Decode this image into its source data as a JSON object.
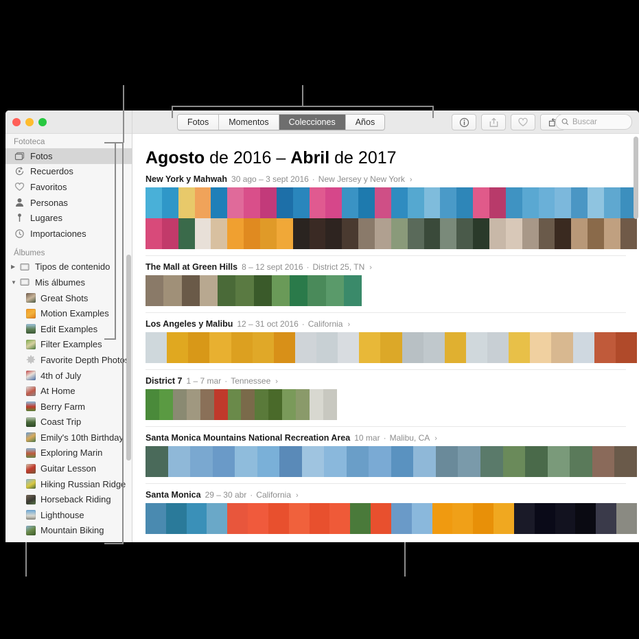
{
  "window": {
    "traffic_lights": [
      "close",
      "minimize",
      "zoom"
    ],
    "colors": {
      "close": "#ff5f57",
      "minimize": "#febc2e",
      "zoom": "#28c840",
      "accent_selected": "#6e6e6e"
    }
  },
  "sidebar": {
    "sections": [
      {
        "header": "Fototeca",
        "items": [
          {
            "label": "Fotos",
            "icon": "photos-stack-icon",
            "selected": true
          },
          {
            "label": "Recuerdos",
            "icon": "memories-icon",
            "selected": false
          },
          {
            "label": "Favoritos",
            "icon": "heart-icon",
            "selected": false
          },
          {
            "label": "Personas",
            "icon": "person-icon",
            "selected": false
          },
          {
            "label": "Lugares",
            "icon": "map-pin-icon",
            "selected": false
          },
          {
            "label": "Importaciones",
            "icon": "clock-icon",
            "selected": false
          }
        ]
      },
      {
        "header": "Álbumes",
        "items": [
          {
            "label": "Tipos de contenido",
            "icon": "folder-icon",
            "expanded": false,
            "group": true
          },
          {
            "label": "Mis álbumes",
            "icon": "folder-icon",
            "expanded": true,
            "group": true
          },
          {
            "label": "Great Shots",
            "icon": "album-thumb",
            "thumb": "linear-gradient(150deg,#6f5a4a,#c8b49a 50%,#4a5a42)"
          },
          {
            "label": "Motion Examples",
            "icon": "album-thumb",
            "thumb": "linear-gradient(150deg,#f79a24,#f2b33c 50%,#e07a18)"
          },
          {
            "label": "Edit Examples",
            "icon": "album-thumb",
            "thumb": "linear-gradient(180deg,#9fc6e0,#5d7f54 55%,#3e5c38)"
          },
          {
            "label": "Filter Examples",
            "icon": "album-thumb",
            "thumb": "linear-gradient(150deg,#7fae4e,#d6d0a0 50%,#4a7a3a)"
          },
          {
            "label": "Favorite Depth Photos",
            "icon": "gear-icon"
          },
          {
            "label": "4th of July",
            "icon": "album-thumb",
            "thumb": "linear-gradient(150deg,#c94a4a,#e8e0d8 45%,#4a6fa8)"
          },
          {
            "label": "At Home",
            "icon": "album-thumb",
            "thumb": "linear-gradient(150deg,#e2e2e2,#c05a4a 55%,#8a8a8a)"
          },
          {
            "label": "Berry Farm",
            "icon": "album-thumb",
            "thumb": "linear-gradient(180deg,#8fc0e2,#c0392b 55%,#5a8a3a)"
          },
          {
            "label": "Coast Trip",
            "icon": "album-thumb",
            "thumb": "linear-gradient(180deg,#b8c9b0,#4a6a3a 50%,#2e4a28)"
          },
          {
            "label": "Emily's 10th Birthday",
            "icon": "album-thumb",
            "thumb": "linear-gradient(150deg,#6aa0d8,#d8a85a 50%,#4a7a4a)"
          },
          {
            "label": "Exploring Marin",
            "icon": "album-thumb",
            "thumb": "linear-gradient(180deg,#8fb8d8,#c05a3a 55%,#6a8a4a)"
          },
          {
            "label": "Guitar Lesson",
            "icon": "album-thumb",
            "thumb": "linear-gradient(150deg,#d8c8b0,#c0392b 50%,#7a5a3a)"
          },
          {
            "label": "Hiking Russian Ridge",
            "icon": "album-thumb",
            "thumb": "linear-gradient(150deg,#8fb8d8,#d8c840 55%,#4a6a3a)"
          },
          {
            "label": "Horseback Riding",
            "icon": "album-thumb",
            "thumb": "linear-gradient(150deg,#7a6a5a,#3a3a32 55%,#5a7a4a)"
          },
          {
            "label": "Lighthouse",
            "icon": "album-thumb",
            "thumb": "linear-gradient(180deg,#6aa8d8,#d8d8d0 60%,#8a8a82)"
          },
          {
            "label": "Mountain Biking",
            "icon": "album-thumb",
            "thumb": "linear-gradient(150deg,#8fb8d8,#6a8a4a 50%,#3a5a2a)"
          }
        ]
      }
    ]
  },
  "toolbar": {
    "tabs": [
      {
        "label": "Fotos",
        "active": false
      },
      {
        "label": "Momentos",
        "active": false
      },
      {
        "label": "Colecciones",
        "active": true
      },
      {
        "label": "Años",
        "active": false
      }
    ],
    "buttons": [
      {
        "name": "info-button",
        "icon": "info-circle-icon"
      },
      {
        "name": "share-button",
        "icon": "share-icon"
      },
      {
        "name": "favorite-button",
        "icon": "heart-icon"
      },
      {
        "name": "rotate-button",
        "icon": "rotate-icon"
      }
    ],
    "search": {
      "placeholder": "Buscar",
      "icon": "search-icon"
    }
  },
  "main": {
    "title": {
      "month_start": "Agosto",
      "year_start": "de 2016",
      "dash": "–",
      "month_end": "Abril",
      "year_end": "de 2017"
    },
    "collections": [
      {
        "name": "New York y Mahwah",
        "date": "30 ago – 3 sept 2016",
        "place": "New Jersey y New York",
        "chevron": "›",
        "rows": 2,
        "photo_height": 45,
        "photos_top": [
          "#49b0d8",
          "#2f97c8",
          "#e8c96a",
          "#f0a35a",
          "#1f7fb8",
          "#e06a9a",
          "#d94f8a",
          "#c23a7a",
          "#1d6fa8",
          "#2a86bc",
          "#e05a90",
          "#d6478a",
          "#3a93c4",
          "#1e7aae",
          "#cf4f86",
          "#2f8cc0",
          "#55a8d0",
          "#7fbcdc",
          "#4a9ac8",
          "#2e86b8",
          "#e05a8a",
          "#b83a6a",
          "#3f93c2",
          "#5aa8d2",
          "#6ab0d8",
          "#7cb8dc",
          "#4a96c4",
          "#8fc4e0",
          "#5fa8d0",
          "#3c8fbe"
        ],
        "photos_bottom": [
          "#d84a7a",
          "#c23a6a",
          "#3a6a4a",
          "#e8e0d8",
          "#d8c0a0",
          "#f0a030",
          "#e08a20",
          "#e09a28",
          "#f0a838",
          "#2a2420",
          "#3a2a24",
          "#2e2420",
          "#4a3a30",
          "#8a7a6a",
          "#b0a090",
          "#8a9a7a",
          "#5a6a5a",
          "#3a4a3a",
          "#7a8a7a",
          "#4a5a4a",
          "#2a3a2a",
          "#c8b8a8",
          "#d8c8b8",
          "#a89888",
          "#6a5a4a",
          "#3a2a20",
          "#b89878",
          "#8a6a4a",
          "#c0a080",
          "#705a48"
        ]
      },
      {
        "name": "The Mall at Green Hills",
        "date": "8 – 12 sept 2016",
        "place": "District 25, TN",
        "chevron": "›",
        "rows": 1,
        "photo_height": 45,
        "photos_top": [
          "#8a7a68",
          "#a09078",
          "#6a5a48",
          "#b8a890",
          "#4a6a38",
          "#5a7a42",
          "#3a5a2a",
          "#6a9a58",
          "#2a7a4a",
          "#4a8a5a",
          "#5a9a6a",
          "#3a8a6a"
        ],
        "photos_bottom": []
      },
      {
        "name": "Los Angeles y Malibu",
        "date": "12 – 31 oct 2016",
        "place": "California",
        "chevron": "›",
        "rows": 1,
        "photo_height": 45,
        "photos_top": [
          "#cfd8dc",
          "#e0a820",
          "#d89818",
          "#e8b030",
          "#dca020",
          "#e0a828",
          "#d89018",
          "#cfd4d8",
          "#c8d0d4",
          "#d8dce0",
          "#e8b838",
          "#dca828",
          "#b8c0c4",
          "#c0c8cc",
          "#e0b030",
          "#d0d8dc",
          "#c8cfd4",
          "#e8c048",
          "#f0d0a0",
          "#d8b890",
          "#cfd8e0",
          "#c05a3a",
          "#b04a2a"
        ],
        "photos_bottom": []
      },
      {
        "name": "District 7",
        "date": "1 – 7 mar",
        "place": "Tennessee",
        "chevron": "›",
        "rows": 1,
        "photo_height": 45,
        "photos_top": [
          "#4a8a3a",
          "#5a9a42",
          "#8a8a72",
          "#a09880",
          "#8a7058",
          "#c0392b",
          "#6a8a4a",
          "#7a6a4a",
          "#5a7a3a",
          "#4a6a2a",
          "#7a9a5a",
          "#8a9a6a",
          "#d8d8d0",
          "#c8c8c0"
        ],
        "photos_bottom": []
      },
      {
        "name": "Santa Monica Mountains National Recreation Area",
        "date": "10 mar",
        "place": "Malibu, CA",
        "chevron": "›",
        "rows": 1,
        "photo_height": 45,
        "photos_top": [
          "#4a6a5a",
          "#8fb8d8",
          "#7aa8d0",
          "#6a9ac8",
          "#8fbcdc",
          "#7ab0d8",
          "#5a8ab8",
          "#9fc4e0",
          "#8ab8dc",
          "#6a9ec8",
          "#7aaad4",
          "#5a92c0",
          "#8fb8d8",
          "#6a8a9a",
          "#7a9aaa",
          "#5a7a6a",
          "#6a8a5a",
          "#4a6a4a",
          "#7a9a7a",
          "#5a7a5a",
          "#8a6a5a",
          "#6a5a4a"
        ],
        "photos_bottom": []
      },
      {
        "name": "Santa Monica",
        "date": "29 – 30 abr",
        "place": "California",
        "chevron": "›",
        "rows": 1,
        "photo_height": 45,
        "photos_top": [
          "#4a8ab0",
          "#2a7a9a",
          "#3a90b8",
          "#6aa8c8",
          "#e8563c",
          "#f05a3c",
          "#e8502e",
          "#f0613c",
          "#e8502e",
          "#ef5a38",
          "#4a7a3a",
          "#e8502e",
          "#6a9ac8",
          "#8ab8dc",
          "#f09a10",
          "#f0a018",
          "#e89008",
          "#f0a820",
          "#1a1a28",
          "#0a0a18",
          "#12121f",
          "#0a0a12",
          "#3a3a4a",
          "#8a8a82"
        ],
        "photos_bottom": []
      }
    ]
  }
}
